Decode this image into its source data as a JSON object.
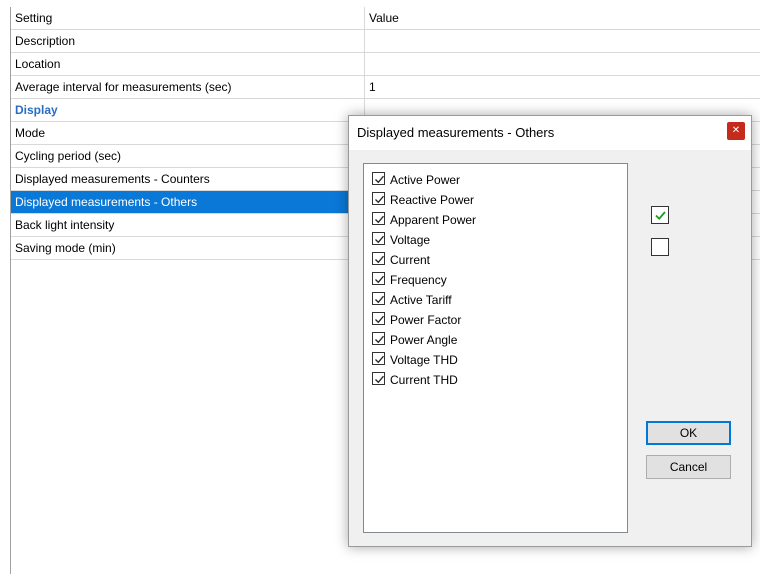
{
  "grid": {
    "header": {
      "setting": "Setting",
      "value": "Value"
    },
    "rows": [
      {
        "setting": "Description",
        "value": ""
      },
      {
        "setting": "Location",
        "value": ""
      },
      {
        "setting": "Average interval for measurements (sec)",
        "value": "1"
      },
      {
        "setting": "Display",
        "value": ""
      },
      {
        "setting": "Mode",
        "value": ""
      },
      {
        "setting": "Cycling period (sec)",
        "value": ""
      },
      {
        "setting": "Displayed measurements - Counters",
        "value": ""
      },
      {
        "setting": "Displayed measurements - Others",
        "value": ""
      },
      {
        "setting": "Back light intensity",
        "value": ""
      },
      {
        "setting": "Saving mode (min)",
        "value": ""
      }
    ]
  },
  "dialog": {
    "title": "Displayed measurements - Others",
    "close_icon": "close-icon",
    "items": [
      {
        "label": "Active Power",
        "checked": true
      },
      {
        "label": "Reactive Power",
        "checked": true
      },
      {
        "label": "Apparent Power",
        "checked": true
      },
      {
        "label": "Voltage",
        "checked": true
      },
      {
        "label": "Current",
        "checked": true
      },
      {
        "label": "Frequency",
        "checked": true
      },
      {
        "label": "Active Tariff",
        "checked": true
      },
      {
        "label": "Power Factor",
        "checked": true
      },
      {
        "label": "Power Angle",
        "checked": true
      },
      {
        "label": "Voltage THD",
        "checked": true
      },
      {
        "label": "Current THD",
        "checked": true
      }
    ],
    "check_all_checked": true,
    "uncheck_all_checked": false,
    "ok_label": "OK",
    "cancel_label": "Cancel"
  },
  "colors": {
    "selection": "#0a78d7",
    "category_text": "#2a6cc2",
    "close_button": "#c42b1c",
    "check_all_mark": "#1a9a1a",
    "default_button_border": "#0078d7"
  }
}
